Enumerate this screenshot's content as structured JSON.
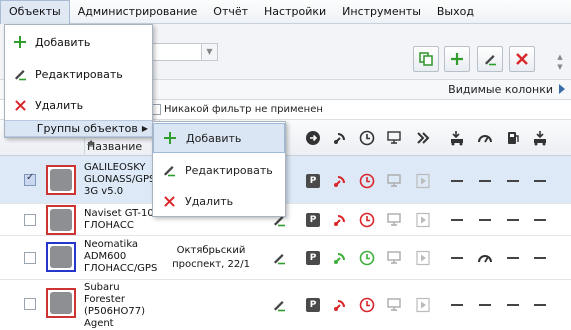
{
  "menubar": {
    "items": [
      "Объекты",
      "Администрирование",
      "Отчёт",
      "Настройки",
      "Инструменты",
      "Выход"
    ],
    "active": "Объекты"
  },
  "dropdown": {
    "items": [
      {
        "label": "Добавить",
        "icon": "plus-icon"
      },
      {
        "label": "Редактировать",
        "icon": "pencil-icon"
      },
      {
        "label": "Удалить",
        "icon": "x-icon"
      },
      {
        "label": "Группы объектов",
        "icon": "chevron-right-icon"
      }
    ]
  },
  "submenu": {
    "items": [
      {
        "label": "Добавить",
        "icon": "plus-icon"
      },
      {
        "label": "Редактировать",
        "icon": "pencil-icon"
      },
      {
        "label": "Удалить",
        "icon": "x-icon"
      }
    ]
  },
  "toolbar": {
    "buttons": [
      "copy-icon",
      "plus-icon",
      "pencil-icon",
      "x-icon"
    ]
  },
  "filterbar": {
    "visible_columns": "Видимые колонки",
    "filter_text": "Никакой фильтр не применен"
  },
  "table": {
    "name_header": "Название",
    "rows": [
      {
        "name": "GALILEOSKY GLONASS/GPS 3G v5.0",
        "address": "",
        "selected": true,
        "frame": "red",
        "signal": "red",
        "clock": "red"
      },
      {
        "name": "Naviset GT-10 ГЛОНАСС",
        "address": "",
        "selected": false,
        "frame": "red",
        "signal": "red",
        "clock": "red"
      },
      {
        "name": "Neomatika ADM600 ГЛОНАСС/GPS",
        "address": "Октябрьский проспект, 22/1",
        "selected": false,
        "frame": "blue",
        "signal": "green",
        "clock": "green"
      },
      {
        "name": "Subaru Forester (Р506НО77) Agent",
        "address": "",
        "selected": false,
        "frame": "red",
        "signal": "red",
        "clock": "red"
      }
    ]
  },
  "colors": {
    "red": "#d9262a",
    "green": "#3fae3a",
    "accent": "#3b6ea8"
  }
}
